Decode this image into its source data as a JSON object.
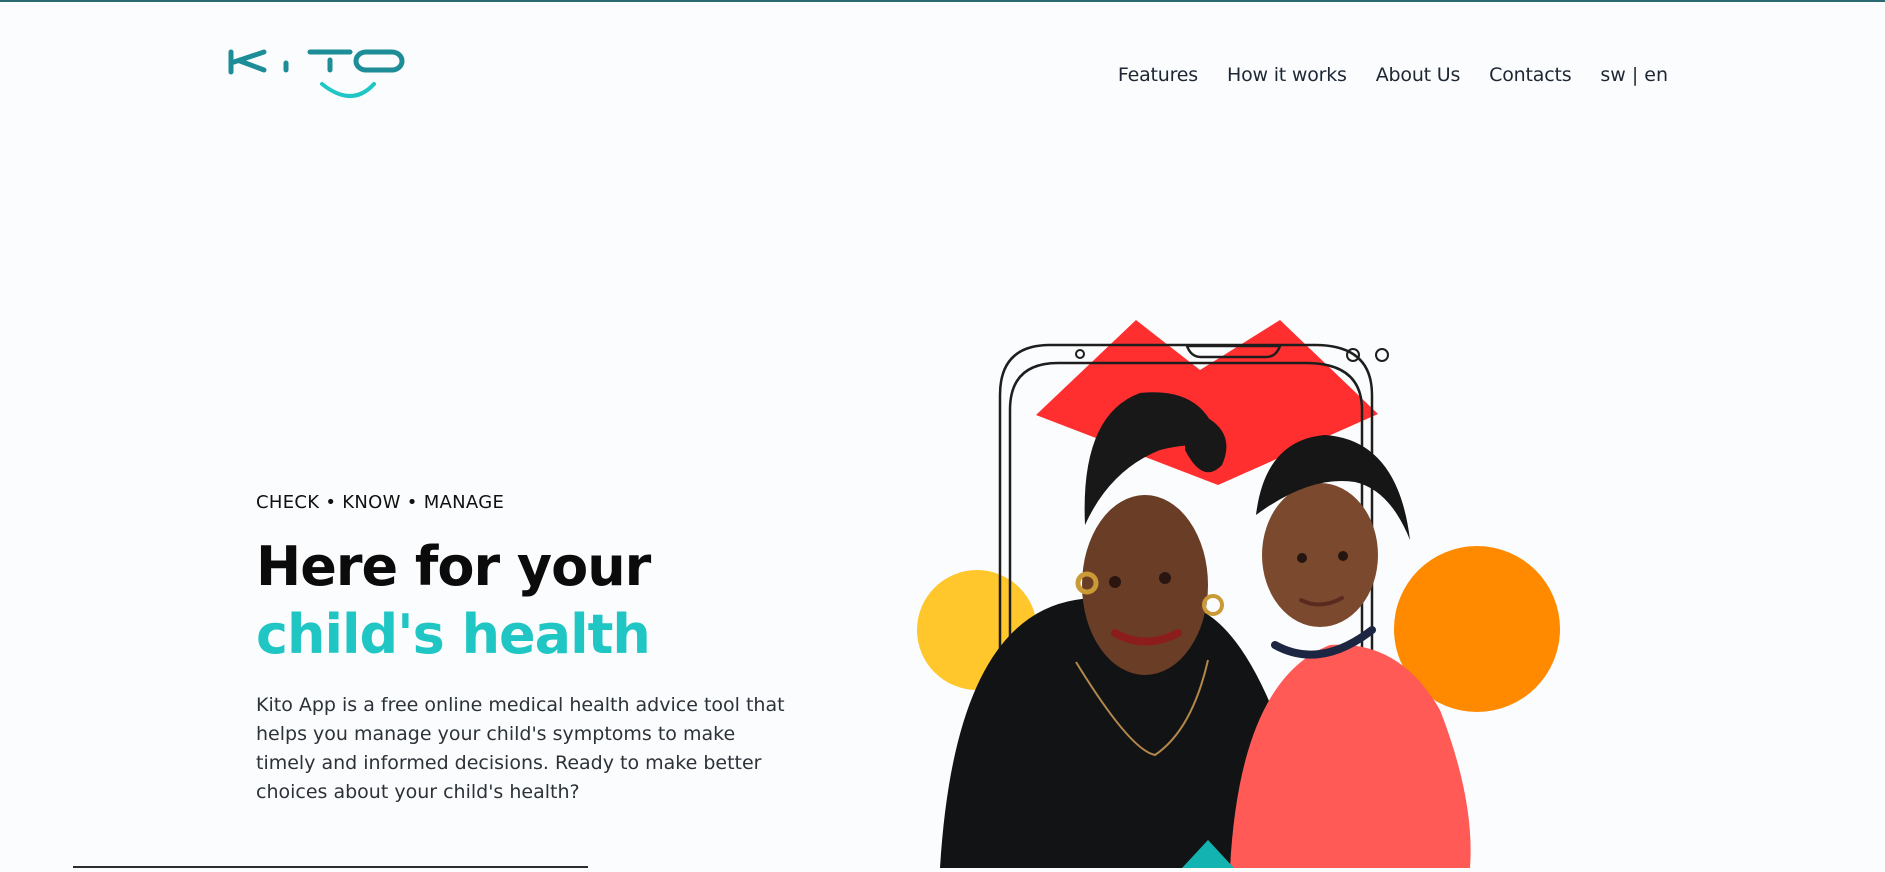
{
  "brand": {
    "logo_text": "KITO",
    "colors": {
      "teal": "#1d8d97",
      "accent": "#1fc6c4",
      "red": "#ff2f2f",
      "yellow": "#ffc72c",
      "orange": "#ff8a00"
    }
  },
  "nav": {
    "items": [
      {
        "label": "Features"
      },
      {
        "label": "How it works"
      },
      {
        "label": "About Us"
      },
      {
        "label": "Contacts"
      }
    ],
    "lang": {
      "sw": "sw",
      "sep": "|",
      "en": "en"
    }
  },
  "hero": {
    "tagline": "CHECK • KNOW • MANAGE",
    "headline_line1": "Here for your",
    "headline_line2": "child's health",
    "intro": "Kito App is a free online medical health advice tool that helps you manage your child's symptoms to make timely and informed decisions. Ready to make better choices about your child's health?"
  }
}
